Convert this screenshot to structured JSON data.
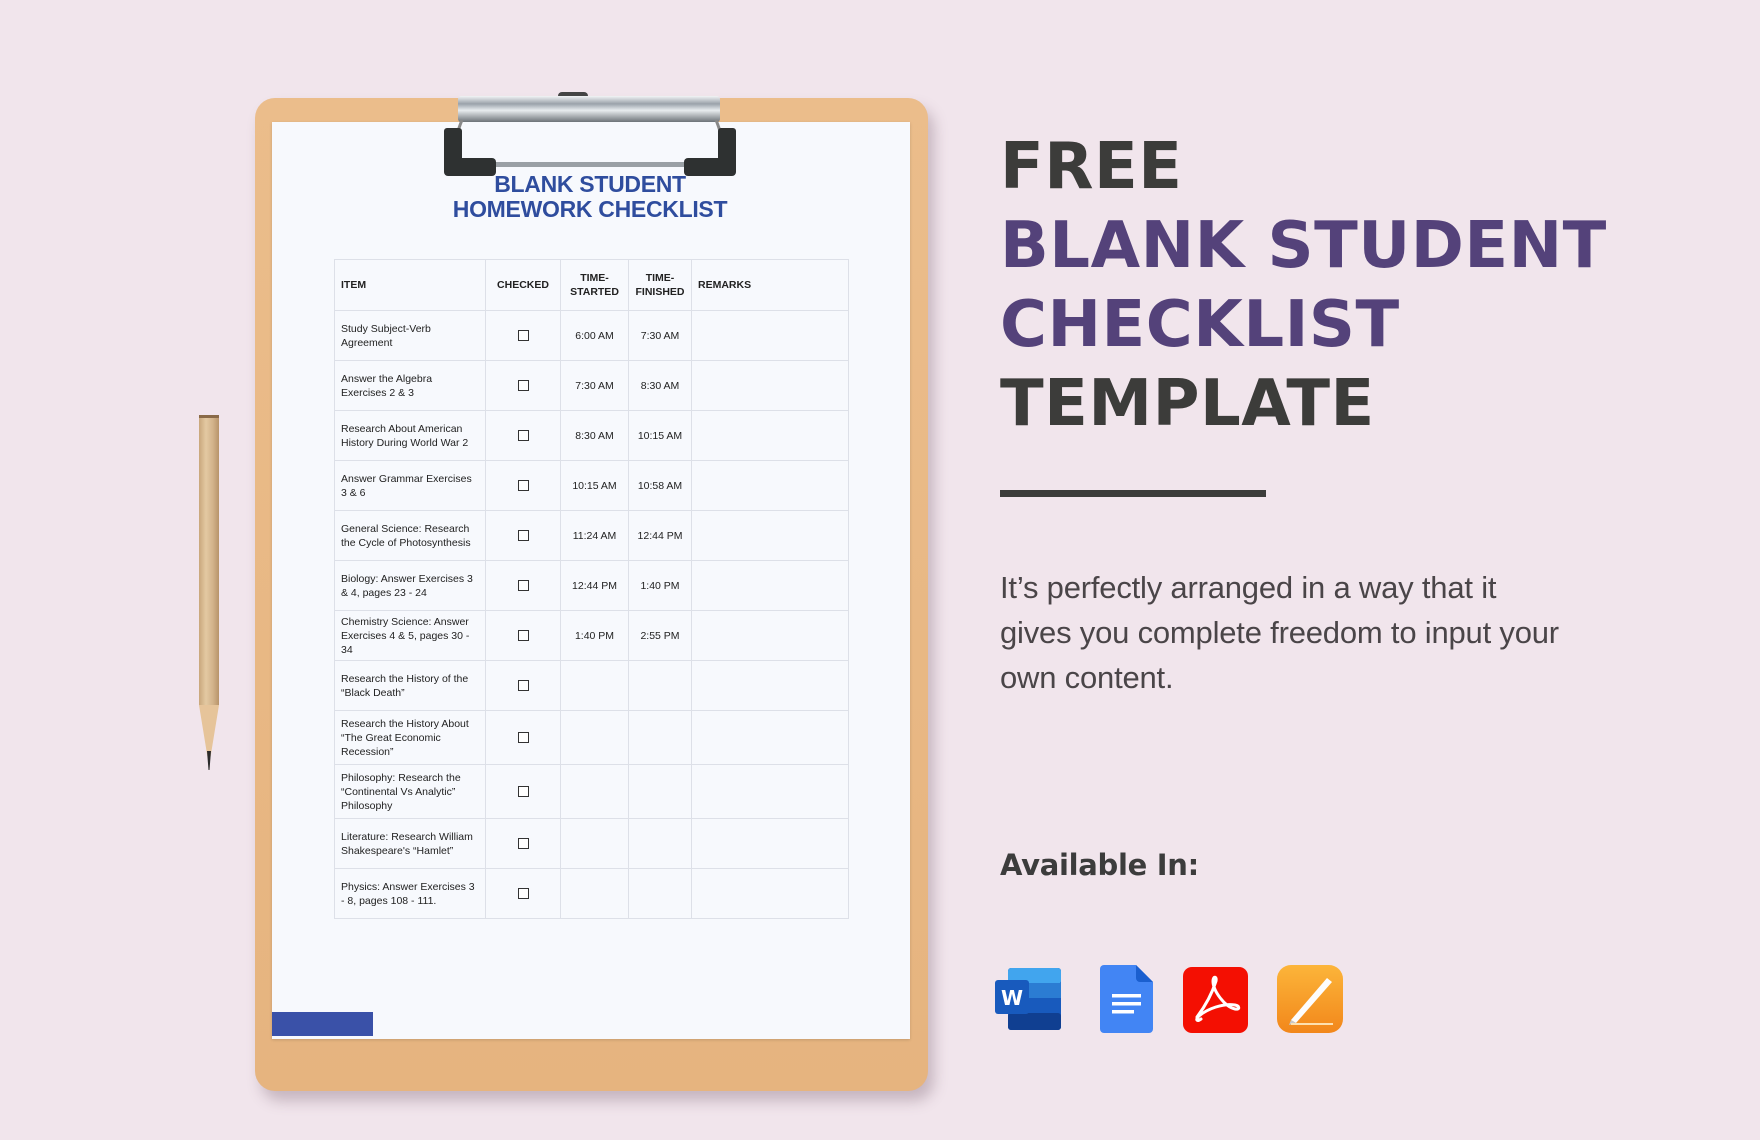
{
  "document": {
    "title_line1": "BLANK STUDENT",
    "title_line2": "HOMEWORK CHECKLIST",
    "accent_color": "#3a51a8",
    "table": {
      "headers": {
        "item": "ITEM",
        "checked": "CHECKED",
        "time_started_1": "TIME-",
        "time_started_2": "STARTED",
        "time_finished_1": "TIME-",
        "time_finished_2": "FINISHED",
        "remarks": "REMARKS"
      },
      "rows": [
        {
          "item": "Study Subject-Verb Agreement",
          "checked": false,
          "started": "6:00 AM",
          "finished": "7:30 AM",
          "remarks": ""
        },
        {
          "item": "Answer the Algebra Exercises 2 & 3",
          "checked": false,
          "started": "7:30 AM",
          "finished": "8:30 AM",
          "remarks": ""
        },
        {
          "item": "Research About American History During World War 2",
          "checked": false,
          "started": "8:30 AM",
          "finished": "10:15 AM",
          "remarks": ""
        },
        {
          "item": "Answer Grammar Exercises 3 & 6",
          "checked": false,
          "started": "10:15 AM",
          "finished": "10:58 AM",
          "remarks": ""
        },
        {
          "item": "General Science: Research the Cycle of Photosynthesis",
          "checked": false,
          "started": "11:24 AM",
          "finished": "12:44 PM",
          "remarks": ""
        },
        {
          "item": "Biology: Answer Exercises 3 & 4, pages 23 - 24",
          "checked": false,
          "started": "12:44 PM",
          "finished": "1:40 PM",
          "remarks": ""
        },
        {
          "item": "Chemistry Science: Answer Exercises 4 & 5, pages 30 - 34",
          "checked": false,
          "started": "1:40 PM",
          "finished": "2:55 PM",
          "remarks": ""
        },
        {
          "item": "Research the History of the “Black Death”",
          "checked": false,
          "started": "",
          "finished": "",
          "remarks": ""
        },
        {
          "item": "Research the History About “The Great Economic Recession”",
          "checked": false,
          "started": "",
          "finished": "",
          "remarks": ""
        },
        {
          "item": "Philosophy: Research the “Continental Vs Analytic” Philosophy",
          "checked": false,
          "started": "",
          "finished": "",
          "remarks": ""
        },
        {
          "item": "Literature: Research William Shakespeare's “Hamlet”",
          "checked": false,
          "started": "",
          "finished": "",
          "remarks": ""
        },
        {
          "item": "Physics: Answer Exercises 3 - 8, pages 108 - 111.",
          "checked": false,
          "started": "",
          "finished": "",
          "remarks": ""
        }
      ]
    }
  },
  "hero": {
    "line1": "FREE",
    "line2": "BLANK STUDENT",
    "line3": "CHECKLIST",
    "line4": "TEMPLATE",
    "dark_color": "#3c3c3a",
    "purple_color": "#54427a"
  },
  "description": "It’s perfectly arranged in a way that it gives you complete freedom to input your own content.",
  "available": {
    "label": "Available In:",
    "formats": [
      {
        "name": "Microsoft Word",
        "icon": "word-icon"
      },
      {
        "name": "Google Docs",
        "icon": "google-docs-icon"
      },
      {
        "name": "Adobe PDF",
        "icon": "pdf-icon"
      },
      {
        "name": "Apple Pages",
        "icon": "pages-icon"
      }
    ]
  }
}
